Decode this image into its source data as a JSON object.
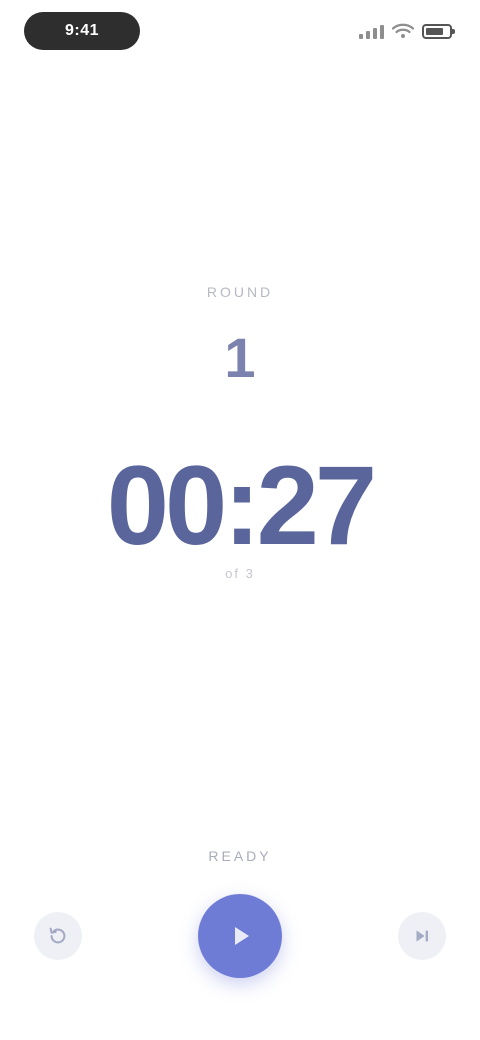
{
  "status_bar": {
    "time": "9:41",
    "battery_level": 0.8
  },
  "timer": {
    "label": "Round",
    "round": "1",
    "time": "00:27",
    "sub_label": "of 3"
  },
  "controls": {
    "state_label": "Ready",
    "reset_icon": "reset-icon",
    "play_icon": "play-icon",
    "skip_icon": "skip-icon"
  },
  "colors": {
    "accent": "#6f7cd6",
    "time_text": "#5a659c",
    "muted_text": "#b7b9c4"
  }
}
